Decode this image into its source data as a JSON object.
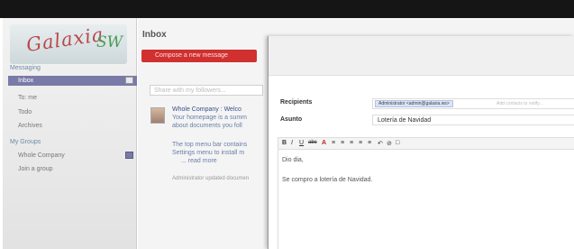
{
  "sidebar": {
    "logo": {
      "text": "Galaxia",
      "suffix": "SW"
    },
    "messaging_label": "Messaging",
    "items": [
      {
        "label": "Inbox"
      },
      {
        "label": "To: me"
      },
      {
        "label": "Todo"
      },
      {
        "label": "Archives"
      }
    ],
    "groups_label": "My Groups",
    "group_items": [
      {
        "label": "Whole Company"
      },
      {
        "label": "Join a group"
      }
    ]
  },
  "main": {
    "title": "Inbox",
    "compose_label": "Compose a new message",
    "share_placeholder": "Share with my followers...",
    "message": {
      "title": "Whole Company : Welco",
      "lines": [
        "Your homepage is a summ",
        "about documents you foll"
      ],
      "lines2": [
        "The top menu bar contains",
        "Settings menu to install m"
      ],
      "read_more": "... read more",
      "meta": "Administrator updated documen"
    }
  },
  "composer": {
    "recipients_label": "Recipients",
    "recipient_tag": "Administrator <admin@galaxia.ws>",
    "recipient_placeholder": "Add contacts to notify...",
    "subject_label": "Asunto",
    "subject_value": "Lotería de Navidad",
    "toolbar": [
      "B",
      "I",
      "U",
      "abc",
      "A",
      "≡",
      "≡",
      "≡",
      "≡",
      "≡",
      "↶",
      "⊘",
      "□"
    ],
    "body": [
      "Dio dia,",
      "Se compro a lotería de Navidad."
    ]
  }
}
